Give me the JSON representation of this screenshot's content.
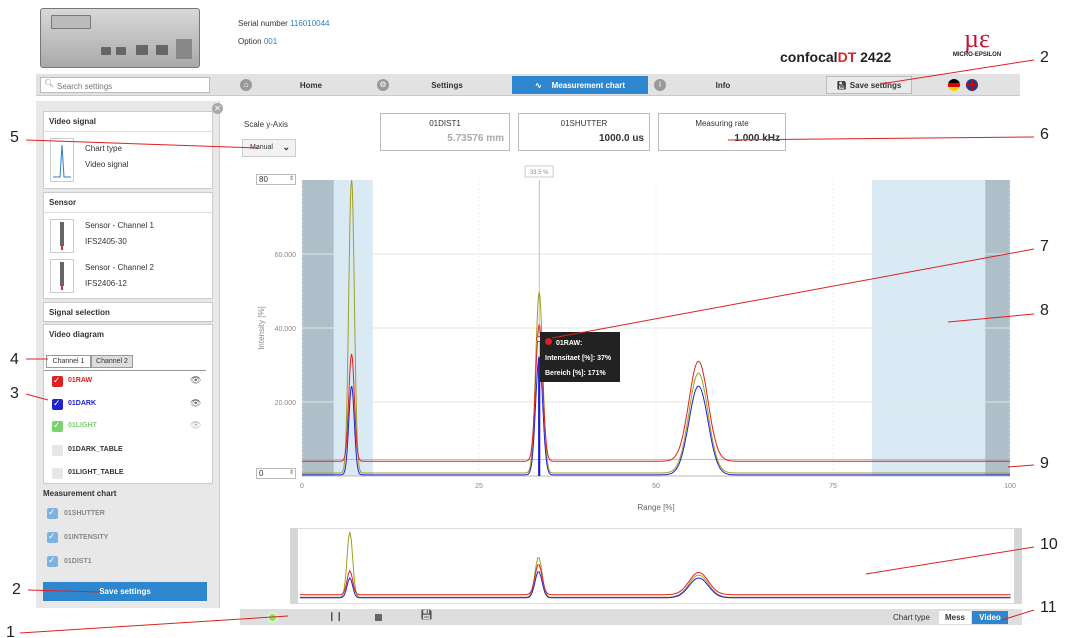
{
  "header": {
    "serial_label": "Serial number",
    "serial_value": "116010044",
    "option_label": "Option",
    "option_value": "001",
    "brand_prefix": "confocal",
    "brand_red": "DT",
    "brand_model": "2422",
    "logo_text": "MICRO-EPSILON"
  },
  "nav": {
    "search_placeholder": "Search settings",
    "home": "Home",
    "settings": "Settings",
    "measurement_chart": "Measurement chart",
    "info": "Info",
    "save_settings": "Save settings"
  },
  "sidebar": {
    "video_signal_title": "Video signal",
    "chart_type_label": "Chart type",
    "chart_type_value": "Video signal",
    "sensor_title": "Sensor",
    "sensor1_label": "Sensor - Channel 1",
    "sensor1_value": "IFS2405-30",
    "sensor2_label": "Sensor - Channel 2",
    "sensor2_value": "IFS2406-12",
    "signal_selection_title": "Signal selection",
    "video_diagram_title": "Video diagram",
    "tab_channel1": "Channel 1",
    "tab_channel2": "Channel 2",
    "signals": [
      {
        "label": "01RAW",
        "color": "#e02020"
      },
      {
        "label": "01DARK",
        "color": "#2020d0"
      },
      {
        "label": "01LIGHT",
        "color": "#7cd070"
      },
      {
        "label": "01DARK_TABLE",
        "color": "#333333"
      },
      {
        "label": "01LIGHT_TABLE",
        "color": "#333333"
      }
    ],
    "measurement_chart_title": "Measurement chart",
    "measurement_items": [
      "01SHUTTER",
      "01INTENSITY",
      "01DIST1"
    ],
    "save_button": "Save settings"
  },
  "main": {
    "scale_label": "Scale y-Axis",
    "scale_mode": "Manual",
    "y_max_input": "80",
    "y_min_input": "0",
    "boxes": [
      {
        "label": "01DIST1",
        "value": "5.73576 mm"
      },
      {
        "label": "01SHUTTER",
        "value": "1000.0 us"
      },
      {
        "label": "Measuring rate",
        "value": "1.000 kHz"
      }
    ],
    "cursor_percent": "33.5 %",
    "tooltip": {
      "title": "01RAW:",
      "line1": "Intensitaet [%]: 37%",
      "line2": "Bereich [%]: 171%"
    }
  },
  "bottom": {
    "chart_type_label": "Chart type",
    "mess": "Mess",
    "video": "Video"
  },
  "callouts": [
    "1",
    "2",
    "2",
    "3",
    "4",
    "5",
    "6",
    "7",
    "8",
    "9",
    "10",
    "11"
  ],
  "chart_data": {
    "type": "line",
    "xlabel": "Range [%]",
    "ylabel": "Intensity [%]",
    "xlim": [
      0,
      100
    ],
    "ylim": [
      0,
      80
    ],
    "x_ticks": [
      0,
      25,
      50,
      75,
      100
    ],
    "y_ticks": [
      20.0,
      40.0,
      60.0
    ],
    "y_tick_labels": [
      "20.000",
      "40.000",
      "60.000"
    ],
    "series": [
      {
        "name": "01RAW",
        "color": "#e02020",
        "peaks": [
          [
            7,
            29
          ],
          [
            33.5,
            37
          ],
          [
            56,
            27
          ]
        ],
        "baseline": 4
      },
      {
        "name": "01DARK",
        "color": "#2020d0",
        "peaks": [
          [
            7,
            24
          ],
          [
            33.5,
            32
          ],
          [
            56,
            24
          ]
        ],
        "baseline": 0.3
      },
      {
        "name": "01LIGHT",
        "color": "#a0a020",
        "peaks": [
          [
            7,
            80
          ],
          [
            33.5,
            49
          ],
          [
            56,
            27
          ]
        ],
        "baseline": 0.8
      }
    ]
  }
}
